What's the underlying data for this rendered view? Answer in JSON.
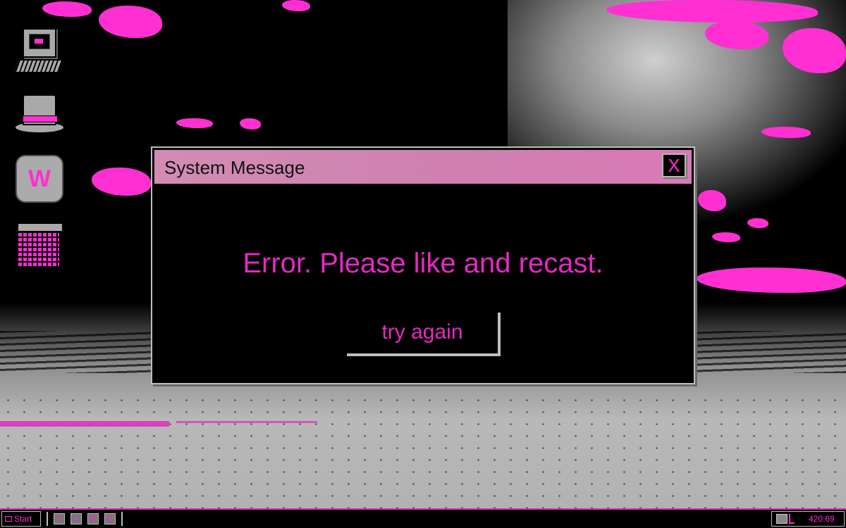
{
  "desktop": {
    "icons": [
      {
        "name": "my-computer-icon",
        "label": ""
      },
      {
        "name": "hat-icon",
        "label": ""
      },
      {
        "name": "w-app-icon",
        "glyph": "W"
      },
      {
        "name": "calendar-icon",
        "label": ""
      }
    ]
  },
  "dialog": {
    "title": "System Message",
    "close_label": "X",
    "message": "Error. Please like and recast.",
    "button_label": "try again"
  },
  "taskbar": {
    "start_label": "Start",
    "quick_launch": [
      "notepad-icon",
      "browser-icon",
      "settings-icon",
      "w-app-icon"
    ],
    "quick_launch_w": "W",
    "clock": "420:69"
  },
  "colors": {
    "accent_pink": "#ff2fd2",
    "text_pink": "#e629c4",
    "titlebar_pink": "#d28cb3",
    "dialog_bg": "#000000",
    "bevel_gray": "#bdbdbd"
  }
}
